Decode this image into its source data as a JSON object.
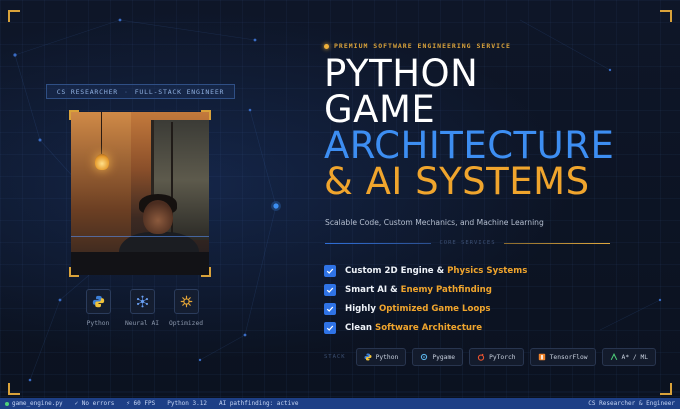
{
  "hero": {
    "tagline": "PREMIUM SOFTWARE ENGINEERING SERVICE",
    "title_line1": "PYTHON",
    "title_line2": "GAME",
    "title_line3": "ARCHITECTURE",
    "title_line4": "& AI SYSTEMS",
    "subtitle": "Scalable Code, Custom Mechanics, and Machine Learning"
  },
  "profile": {
    "role_left": "CS RESEARCHER",
    "role_sep": "·",
    "role_right": "FULL-STACK ENGINEER"
  },
  "skills": [
    {
      "label": "Python",
      "icon": "python-icon"
    },
    {
      "label": "Neural AI",
      "icon": "neural-network-icon"
    },
    {
      "label": "Optimized",
      "icon": "gear-icon"
    }
  ],
  "core_services": {
    "heading": "CORE SERVICES",
    "items": [
      {
        "pre": "Custom 2D Engine &",
        "highlight": "Physics Systems",
        "post": ""
      },
      {
        "pre": "Smart AI &",
        "highlight": "Enemy Pathfinding",
        "post": ""
      },
      {
        "pre": "Highly",
        "highlight": "Optimized Game Loops",
        "post": ""
      },
      {
        "pre": "Clean",
        "highlight": "Software Architecture",
        "post": ""
      }
    ]
  },
  "stack": {
    "label": "STACK",
    "items": [
      {
        "label": "Python",
        "icon": "python-icon"
      },
      {
        "label": "Pygame",
        "icon": "pygame-icon"
      },
      {
        "label": "PyTorch",
        "icon": "pytorch-icon"
      },
      {
        "label": "TensorFlow",
        "icon": "tensorflow-icon"
      },
      {
        "label": "A* / ML",
        "icon": "astar-icon"
      }
    ]
  },
  "statusbar": {
    "file": "game_engine.py",
    "errors": "✓ No errors",
    "fps": "⚡ 60 FPS",
    "version": "Python 3.12",
    "ai": "AI pathfinding: active",
    "right": "CS Researcher & Engineer"
  },
  "colors": {
    "background": "#0c1322",
    "accent_blue": "#3d8ef2",
    "accent_gold": "#f0a52d",
    "statusbar": "#1d3f86"
  }
}
